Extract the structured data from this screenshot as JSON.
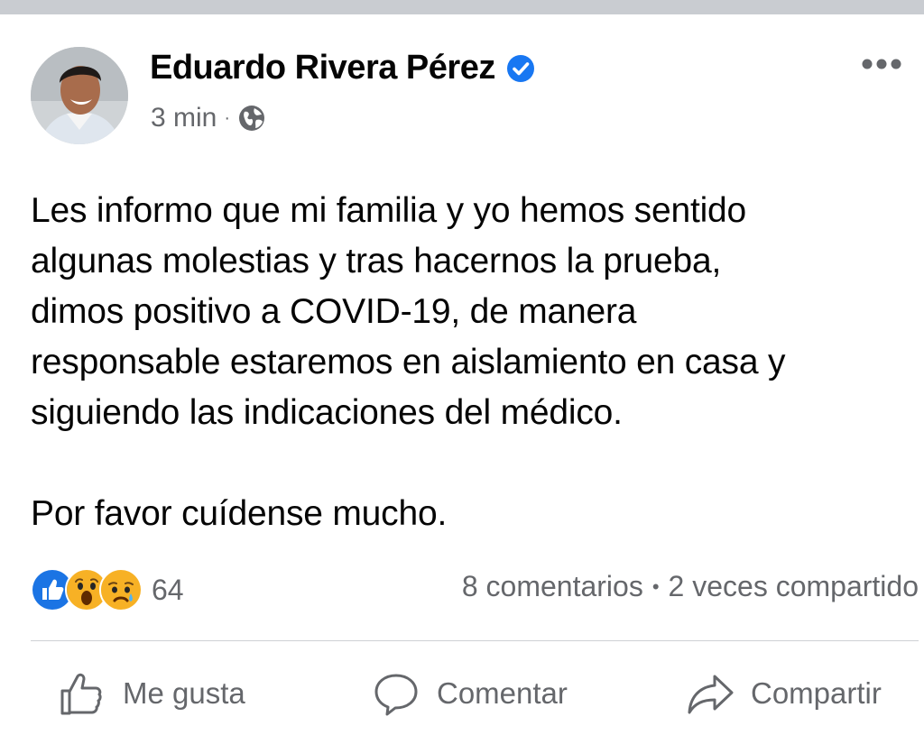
{
  "post": {
    "author": "Eduardo Rivera Pérez",
    "verified": true,
    "timestamp": "3 min",
    "meta_separator": "·",
    "privacy_icon": "globe-icon",
    "text_lines": [
      "Les informo que mi familia y yo hemos sentido",
      "algunas molestias y tras hacernos la prueba,",
      "dimos positivo a COVID-19, de manera",
      "responsable estaremos en aislamiento en casa y",
      "siguiendo las indicaciones del médico.",
      "Por favor cuídense mucho."
    ]
  },
  "reactions": {
    "icons": [
      "like-icon",
      "wow-icon",
      "sad-icon"
    ],
    "count": "64"
  },
  "stats": {
    "comments": "8 comentarios",
    "separator": "•",
    "shares": "2 veces compartido"
  },
  "actions": {
    "like": "Me gusta",
    "comment": "Comentar",
    "share": "Compartir"
  },
  "colors": {
    "verified": "#1877f2",
    "secondary_text": "#65676b",
    "like_blue": "#1b74e4",
    "emoji_yellow": "#f7b125"
  }
}
